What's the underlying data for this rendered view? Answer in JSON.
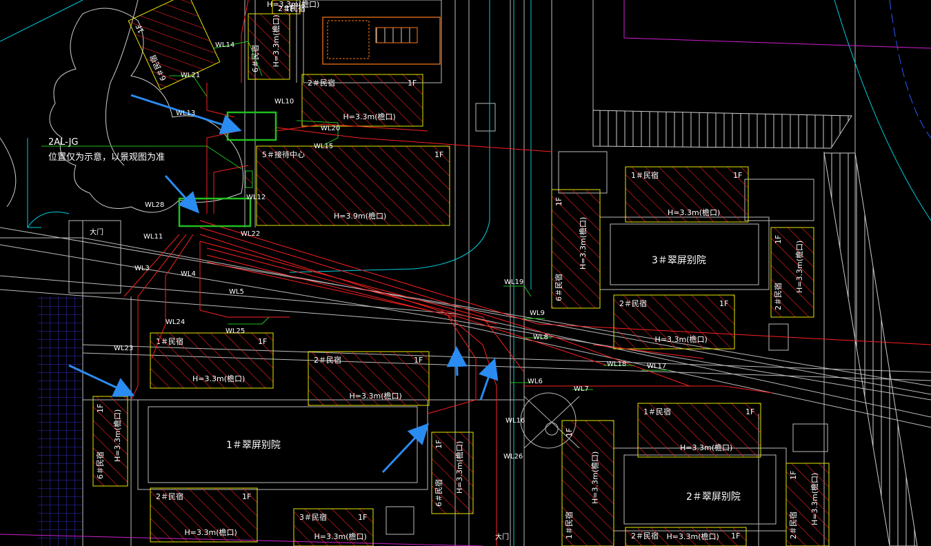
{
  "colors": {
    "background": "#000000",
    "wire_red": "#ff2020",
    "road_white": "#d0d0d0",
    "cyan": "#00d0e0",
    "magenta": "#d020d0",
    "yellow": "#e8e800",
    "green_box": "#20c020",
    "arrow_blue": "#2a8cf0",
    "orange": "#ff7a1a",
    "blue_hatch": "#4040ff"
  },
  "annotation": {
    "panel_id": "2AL-JG",
    "note": "位置仅为示意，以景观图为准"
  },
  "gates": [
    "大门",
    "大门"
  ],
  "circuits": [
    "WL14",
    "WL21",
    "WL13",
    "WL10",
    "WL20",
    "WL15",
    "WL12",
    "WL28",
    "WL11",
    "WL22",
    "WL3",
    "WL4",
    "WL5",
    "WL24",
    "WL25",
    "WL23",
    "WL19",
    "WL9",
    "WL8",
    "WL6",
    "WL7",
    "WL18",
    "WL17",
    "WL16",
    "WL26"
  ],
  "buildings": [
    {
      "type": "6＃民宿",
      "floor": "1F",
      "height": ""
    },
    {
      "type": "6＃民宿",
      "floor": "",
      "height": "H=3.3m(檐口)"
    },
    {
      "type": "2＃民宿",
      "floor": "1F",
      "height": "H=3.3m(檐口)"
    },
    {
      "type": "5＃接待中心",
      "floor": "1F",
      "height": "H=3.9m(檐口)"
    },
    {
      "type": "1＃民宿",
      "floor": "1F",
      "height": "H=3.3m(檐口)"
    },
    {
      "type": "2＃民宿",
      "floor": "1F",
      "height": "H=3.3m(檐口)"
    },
    {
      "type": "2＃民宿",
      "floor": "1F",
      "height": "H=3.3m(檐口)"
    },
    {
      "type": "6＃民宿",
      "floor": "1F",
      "height": "H=3.3m(檐口)"
    },
    {
      "type": "2＃民宿",
      "floor": "1F",
      "height": "H=3.3m(檐口)"
    },
    {
      "type": "1＃民宿",
      "floor": "1F",
      "height": "H=3.3m(檐口)"
    },
    {
      "type": "1＃民宿",
      "floor": "1F",
      "height": "H=3.3m(檐口)"
    },
    {
      "type": "6＃民宿",
      "floor": "1F",
      "height": "H=3.3m(檐口)"
    },
    {
      "type": "2＃民宿",
      "floor": "1F",
      "height": "H=3.3m(檐口)"
    },
    {
      "type": "3＃民宿",
      "floor": "1F",
      "height": "H=3.3m(檐口)"
    },
    {
      "type": "6＃民宿",
      "floor": "1F",
      "height": "H=3.3m(檐口)"
    },
    {
      "type": "1＃民宿",
      "floor": "1F",
      "height": "H=3.3m(檐口)"
    },
    {
      "type": "2＃民宿",
      "floor": "1F",
      "height": "H=3.3m(檐口)"
    },
    {
      "type": "2＃民宿",
      "floor": "1F",
      "height": "H=3.3m(檐口)"
    },
    {
      "type": "2＃民宿",
      "floor": "1F",
      "height": "H=3.3m(檐口)"
    }
  ],
  "courtyards": [
    "3＃翠屏别院",
    "1＃翠屏别院",
    "2＃翠屏别院"
  ]
}
